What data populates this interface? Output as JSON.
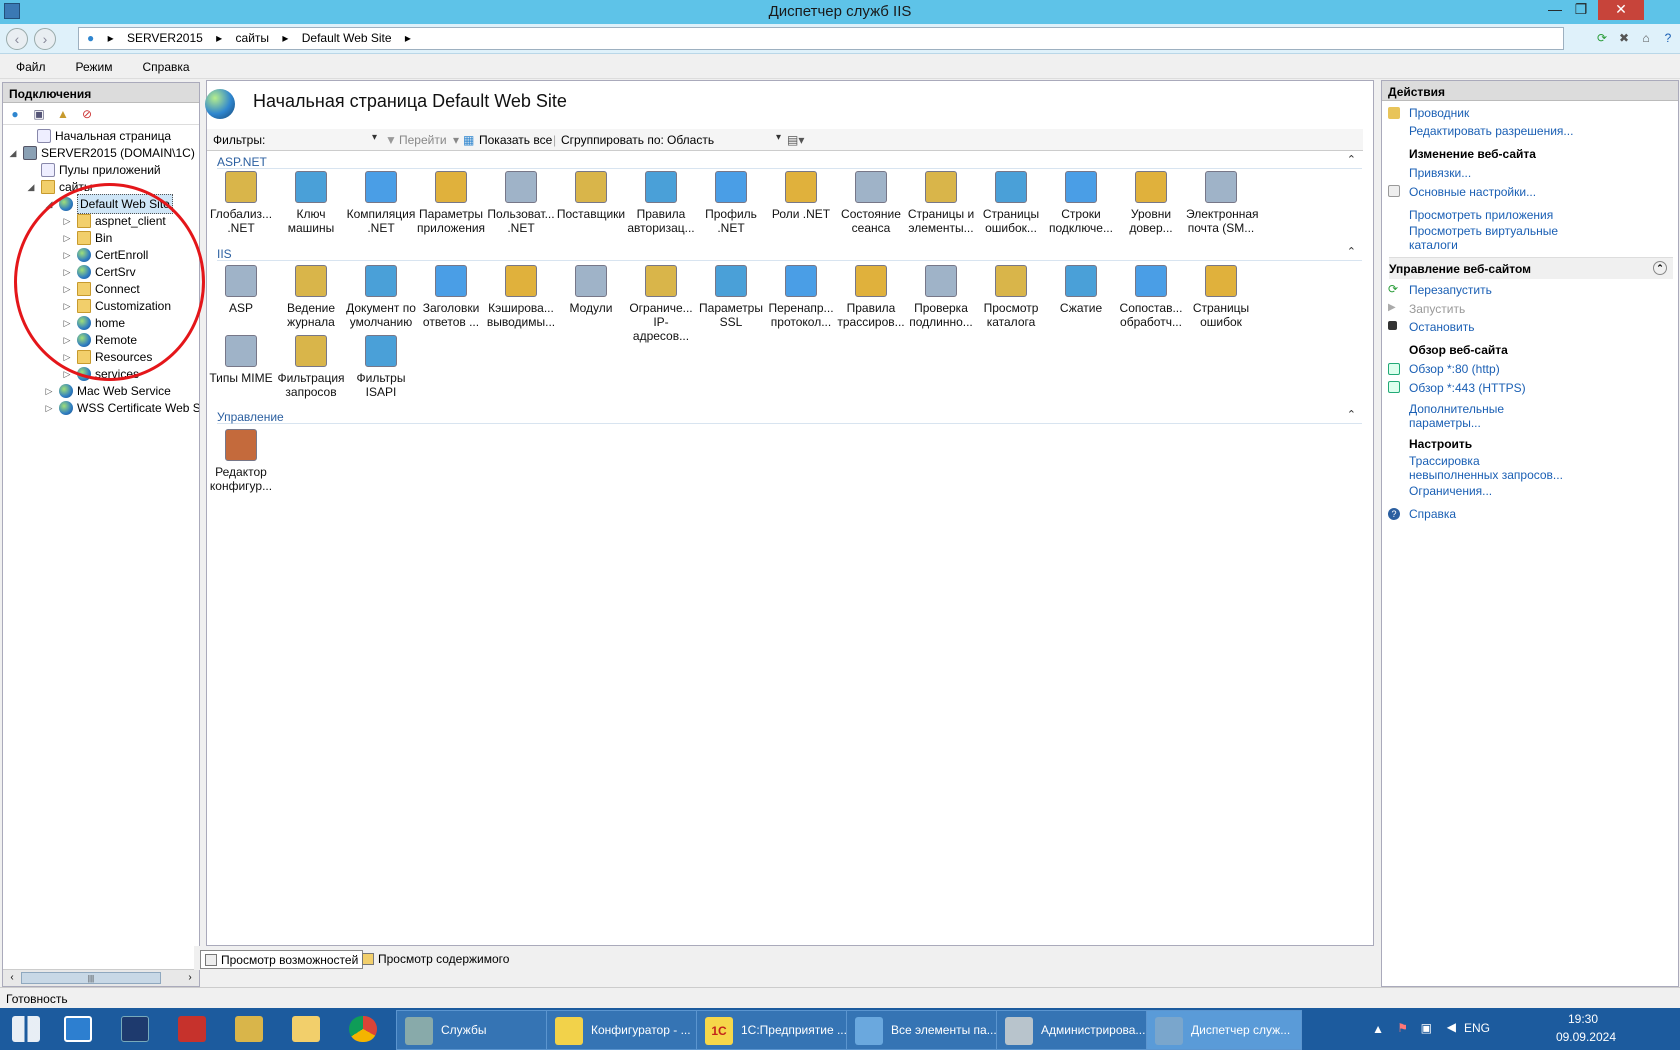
{
  "window": {
    "title": "Диспетчер служб IIS",
    "minimize": "—",
    "restore": "❐",
    "close": "✕"
  },
  "address": {
    "parts": [
      "SERVER2015",
      "сайты",
      "Default Web Site"
    ],
    "sep": "▸"
  },
  "menu": {
    "file": "Файл",
    "mode": "Режим",
    "help": "Справка"
  },
  "connections": {
    "title": "Подключения",
    "tree": [
      {
        "label": "Начальная страница"
      },
      {
        "label": "SERVER2015 (DOMAIN\\1C)"
      },
      {
        "label": "Пулы приложений"
      },
      {
        "label": "сайты"
      },
      {
        "label": "Default Web Site"
      },
      {
        "label": "aspnet_client"
      },
      {
        "label": "Bin"
      },
      {
        "label": "CertEnroll"
      },
      {
        "label": "CertSrv"
      },
      {
        "label": "Connect"
      },
      {
        "label": "Customization"
      },
      {
        "label": "home"
      },
      {
        "label": "Remote"
      },
      {
        "label": "Resources"
      },
      {
        "label": "services"
      },
      {
        "label": "Mac Web Service"
      },
      {
        "label": "WSS Certificate Web S"
      }
    ]
  },
  "center": {
    "title": "Начальная страница Default Web Site",
    "filter_label": "Фильтры:",
    "go": "Перейти",
    "show_all": "Показать все",
    "group_by": "Сгруппировать по:",
    "group_value": "Область",
    "sections": {
      "aspnet": "ASP.NET",
      "iis": "IIS",
      "management": "Управление"
    },
    "aspnet_features": [
      [
        "Глобализ...",
        ".NET"
      ],
      [
        "Ключ",
        "машины"
      ],
      [
        "Компиляция",
        ".NET"
      ],
      [
        "Параметры",
        "приложения"
      ],
      [
        "Пользоват...",
        ".NET"
      ],
      [
        "Поставщики",
        ""
      ],
      [
        "Правила",
        "авторизац..."
      ],
      [
        "Профиль",
        ".NET"
      ],
      [
        "Роли .NET",
        ""
      ],
      [
        "Состояние",
        "сеанса"
      ],
      [
        "Страницы и",
        "элементы..."
      ],
      [
        "Страницы",
        "ошибок..."
      ],
      [
        "Строки",
        "подключе..."
      ],
      [
        "Уровни",
        "довер..."
      ],
      [
        "Электронная",
        "почта (SM..."
      ]
    ],
    "iis_features": [
      [
        "ASP",
        ""
      ],
      [
        "Ведение",
        "журнала"
      ],
      [
        "Документ по",
        "умолчанию"
      ],
      [
        "Заголовки",
        "ответов ..."
      ],
      [
        "Кэширова...",
        "выводимы..."
      ],
      [
        "Модули",
        ""
      ],
      [
        "Ограниче...",
        "IP-адресов..."
      ],
      [
        "Параметры",
        "SSL"
      ],
      [
        "Перенапр...",
        "протокол..."
      ],
      [
        "Правила",
        "трассиров..."
      ],
      [
        "Проверка",
        "подлинно..."
      ],
      [
        "Просмотр",
        "каталога"
      ],
      [
        "Сжатие",
        ""
      ],
      [
        "Сопостав...",
        "обработч..."
      ],
      [
        "Страницы",
        "ошибок"
      ],
      [
        "Типы MIME",
        ""
      ],
      [
        "Фильтрация",
        "запросов"
      ],
      [
        "Фильтры",
        "ISAPI"
      ]
    ],
    "mgmt_features": [
      [
        "Редактор",
        "конфигур..."
      ]
    ]
  },
  "actions": {
    "title": "Действия",
    "explorer": "Проводник",
    "edit_permissions": "Редактировать разрешения...",
    "edit_site": "Изменение веб-сайта",
    "bindings": "Привязки...",
    "basic_settings": "Основные настройки...",
    "view_apps": "Просмотреть приложения",
    "view_vdirs_1": "Просмотреть виртуальные",
    "view_vdirs_2": "каталоги",
    "manage_site": "Управление веб-сайтом",
    "restart": "Перезапустить",
    "start": "Запустить",
    "stop": "Остановить",
    "browse_site": "Обзор веб-сайта",
    "browse_80": "Обзор *:80 (http)",
    "browse_443": "Обзор *:443 (HTTPS)",
    "advanced_1": "Дополнительные",
    "advanced_2": "параметры...",
    "configure": "Настроить",
    "tracing_1": "Трассировка",
    "tracing_2": "невыполненных запросов...",
    "limits": "Ограничения...",
    "help": "Справка"
  },
  "viewtabs": {
    "features": "Просмотр возможностей",
    "content": "Просмотр содержимого"
  },
  "status": "Готовность",
  "taskbar": {
    "tasks": [
      "Службы",
      "Конфигуратор - ...",
      "1С:Предприятие ...",
      "Все элементы па...",
      "Администрирова...",
      "Диспетчер служ..."
    ],
    "lang": "ENG",
    "time": "19:30",
    "date": "09.09.2024"
  },
  "colors": {
    "accent": "#1a5fb4",
    "titlebar": "#5ec3e8",
    "taskbar": "#1c5b9e",
    "highlight_circle": "#e4161a"
  }
}
